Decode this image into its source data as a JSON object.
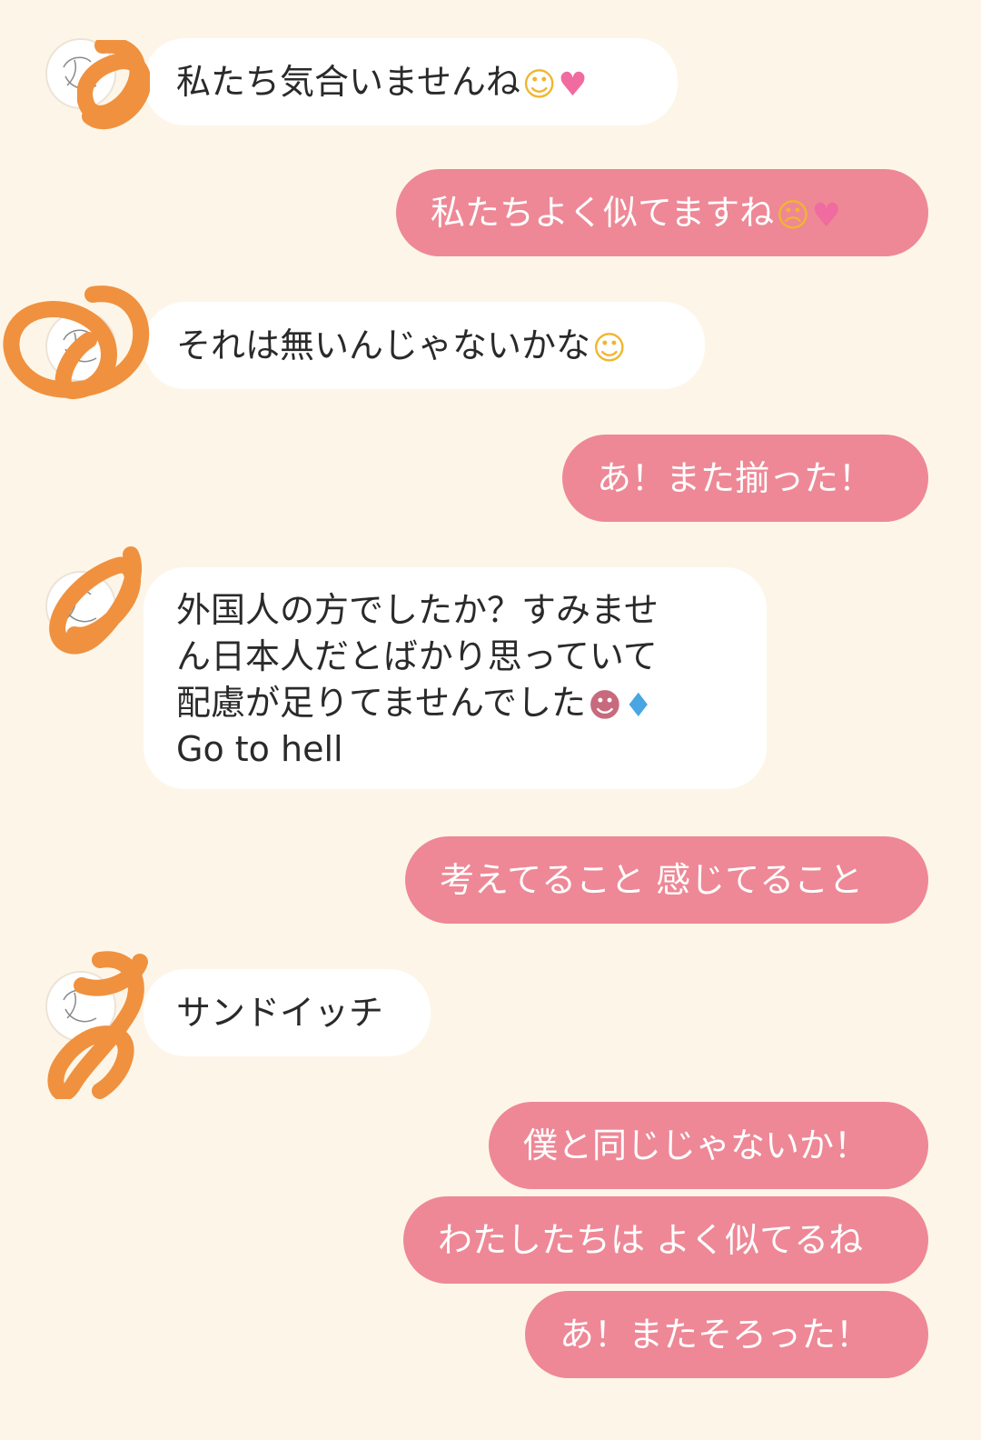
{
  "messages": [
    {
      "dir": "in",
      "text": "私たち気合いませんね",
      "emoji": [
        "smiling-face-icon",
        "two-hearts-icon"
      ]
    },
    {
      "dir": "out",
      "text": "私たちよく似てますね",
      "emoji": [
        "pleading-face-icon",
        "two-hearts-icon"
      ]
    },
    {
      "dir": "in",
      "text": "それは無いんじゃないかな",
      "emoji": [
        "smiling-face-icon"
      ]
    },
    {
      "dir": "out",
      "text": "あ！また揃った！"
    },
    {
      "dir": "in",
      "lines": [
        "外国人の方でしたか？すみませ",
        "ん日本人だとばかり思っていて",
        "配慮が足りてませんでした",
        "Go to hell"
      ],
      "emoji_line": 2,
      "emoji": [
        "person-bowing-icon",
        "sweat-droplets-icon"
      ]
    },
    {
      "dir": "out",
      "text": "考えてること 感じてること"
    },
    {
      "dir": "in",
      "text": "サンドイッチ"
    },
    {
      "dir": "out",
      "text": "僕と同じじゃないか！"
    },
    {
      "dir": "out",
      "text": "わたしたちは よく似てるね"
    },
    {
      "dir": "out",
      "text": "あ！またそろった！"
    }
  ],
  "emoji_glyphs": {
    "smiling-face-icon": "☺",
    "two-hearts-icon": "♥",
    "pleading-face-icon": "☹",
    "person-bowing-icon": "☻",
    "sweat-droplets-icon": "♦"
  },
  "colors": {
    "background": "#fdf6e8",
    "incoming_bubble": "#ffffff",
    "outgoing_bubble": "#ee8896",
    "outgoing_text": "#ffffff",
    "incoming_text": "#2a2a2a",
    "scribble": "#f0913f"
  }
}
